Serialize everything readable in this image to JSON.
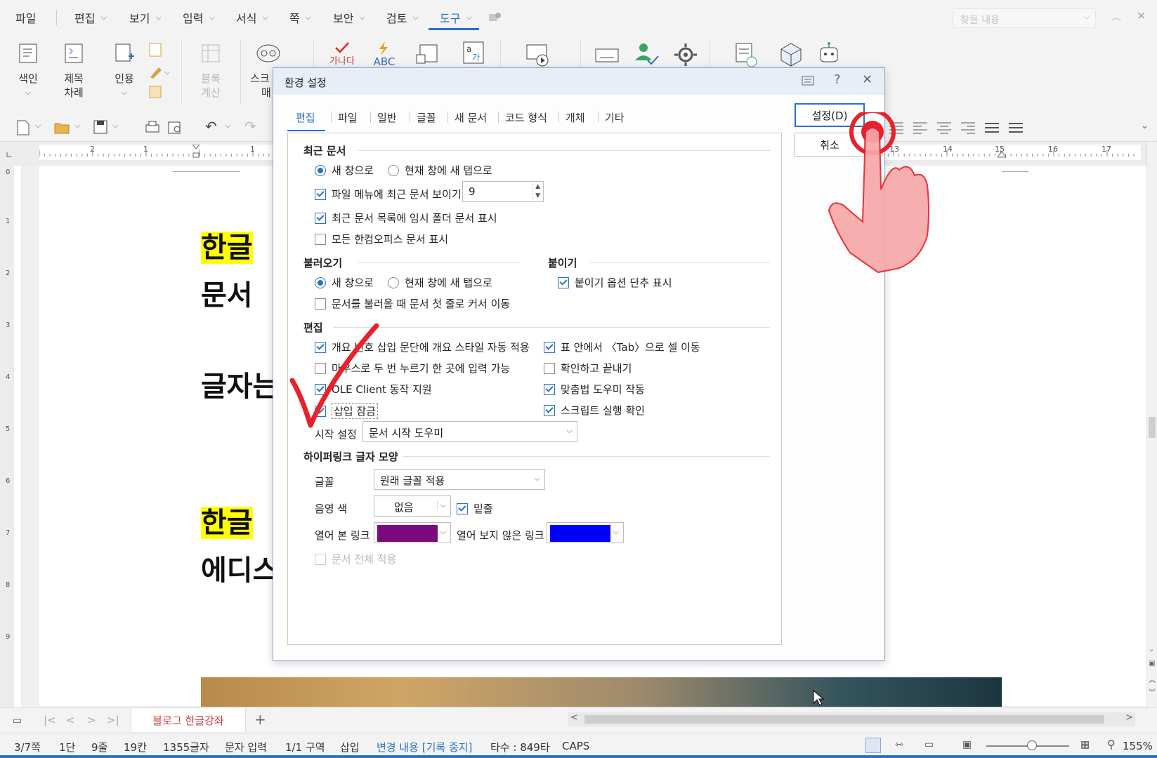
{
  "menubar": {
    "items": [
      "파일",
      "편집",
      "보기",
      "입력",
      "서식",
      "쪽",
      "보안",
      "검토",
      "도구"
    ],
    "search_placeholder": "찾을 내용"
  },
  "ribbon": {
    "index": "색인",
    "toc": "제목 차례",
    "citation": "인용",
    "block_calc": "블록 계산",
    "script_label": "스크",
    "script_label2": "매",
    "spell_label": "가나다",
    "abc_label": "ABC"
  },
  "dialog": {
    "title": "환경 설정",
    "tabs": [
      "편집",
      "파일",
      "일반",
      "글꼴",
      "새 문서",
      "코드 형식",
      "개체",
      "기타"
    ],
    "ok_button": "설정(D)",
    "cancel_button": "취소",
    "recent": {
      "title": "최근 문서",
      "radio_new_window": "새 창으로",
      "radio_new_tab": "현재 창에 새 탭으로",
      "show_recent_in_file_menu": "파일 메뉴에 최근 문서 보이기",
      "recent_count": "9",
      "show_temp_folder": "최근 문서 목록에 임시 폴더 문서 표시",
      "show_all_hancom": "모든 한컴오피스 문서 표시"
    },
    "open": {
      "title": "불러오기",
      "radio_new_window": "새 창으로",
      "radio_new_tab": "현재 창에 새 탭으로",
      "cursor_first_line": "문서를 불러올 때 문서 첫 줄로 커서 이동"
    },
    "paste": {
      "title": "붙이기",
      "show_paste_options": "붙이기 옵션 단추 표시"
    },
    "edit": {
      "title": "편집",
      "outline_style": "개요 번호 삽입 문단에 개요 스타일 자동 적용",
      "tab_in_table": "표 안에서 〈Tab〉으로 셀 이동",
      "double_click_input": "마우스로 두 번 누르기 한 곳에 입력 가능",
      "confirm_exit": "확인하고 끝내기",
      "ole_client": "OLE Client 동작 지원",
      "spell_helper": "맞춤법 도우미 작동",
      "insert_lock": "삽입 잠금",
      "script_confirm": "스크립트 실행 확인",
      "start_setting_label": "시작 설정",
      "start_setting_value": "문서 시작 도우미"
    },
    "hyperlink": {
      "title": "하이퍼링크 글자 모양",
      "font_label": "글꼴",
      "font_value": "원래 글꼴 적용",
      "shade_label": "음영 색",
      "shade_value": "없음",
      "underline": "밑줄",
      "visited_label": "열어 본 링크",
      "visited_color": "#7a0a7e",
      "unvisited_label": "열어 보지 않은 링크",
      "unvisited_color": "#0000ff",
      "apply_all": "문서 전체 적용"
    }
  },
  "document": {
    "lines": [
      "한글",
      "문서",
      "글자는",
      "한글",
      "에디스"
    ]
  },
  "tabbar": {
    "doc_tab": "블로그 한글강좌",
    "add": "+"
  },
  "statusbar": {
    "page": "3/7쪽",
    "column": "1단",
    "line": "9줄",
    "col": "19칸",
    "chars": "1355글자",
    "mode": "문자 입력",
    "section": "1/1 구역",
    "insert": "삽입",
    "track": "변경 내용 [기록 중지]",
    "typing": "타수 : 849타",
    "caps": "CAPS",
    "zoom": "155%"
  },
  "ruler": {
    "labels": [
      "2",
      "1",
      "1",
      "13",
      "14",
      "15",
      "16",
      "17"
    ],
    "vlabels": [
      "0",
      "1",
      "2",
      "3",
      "4",
      "5",
      "6",
      "7",
      "8",
      "9"
    ]
  },
  "colors": {
    "accent": "#2a6fc9",
    "highlight": "#ffff00",
    "annotation_red": "#e8212b"
  }
}
